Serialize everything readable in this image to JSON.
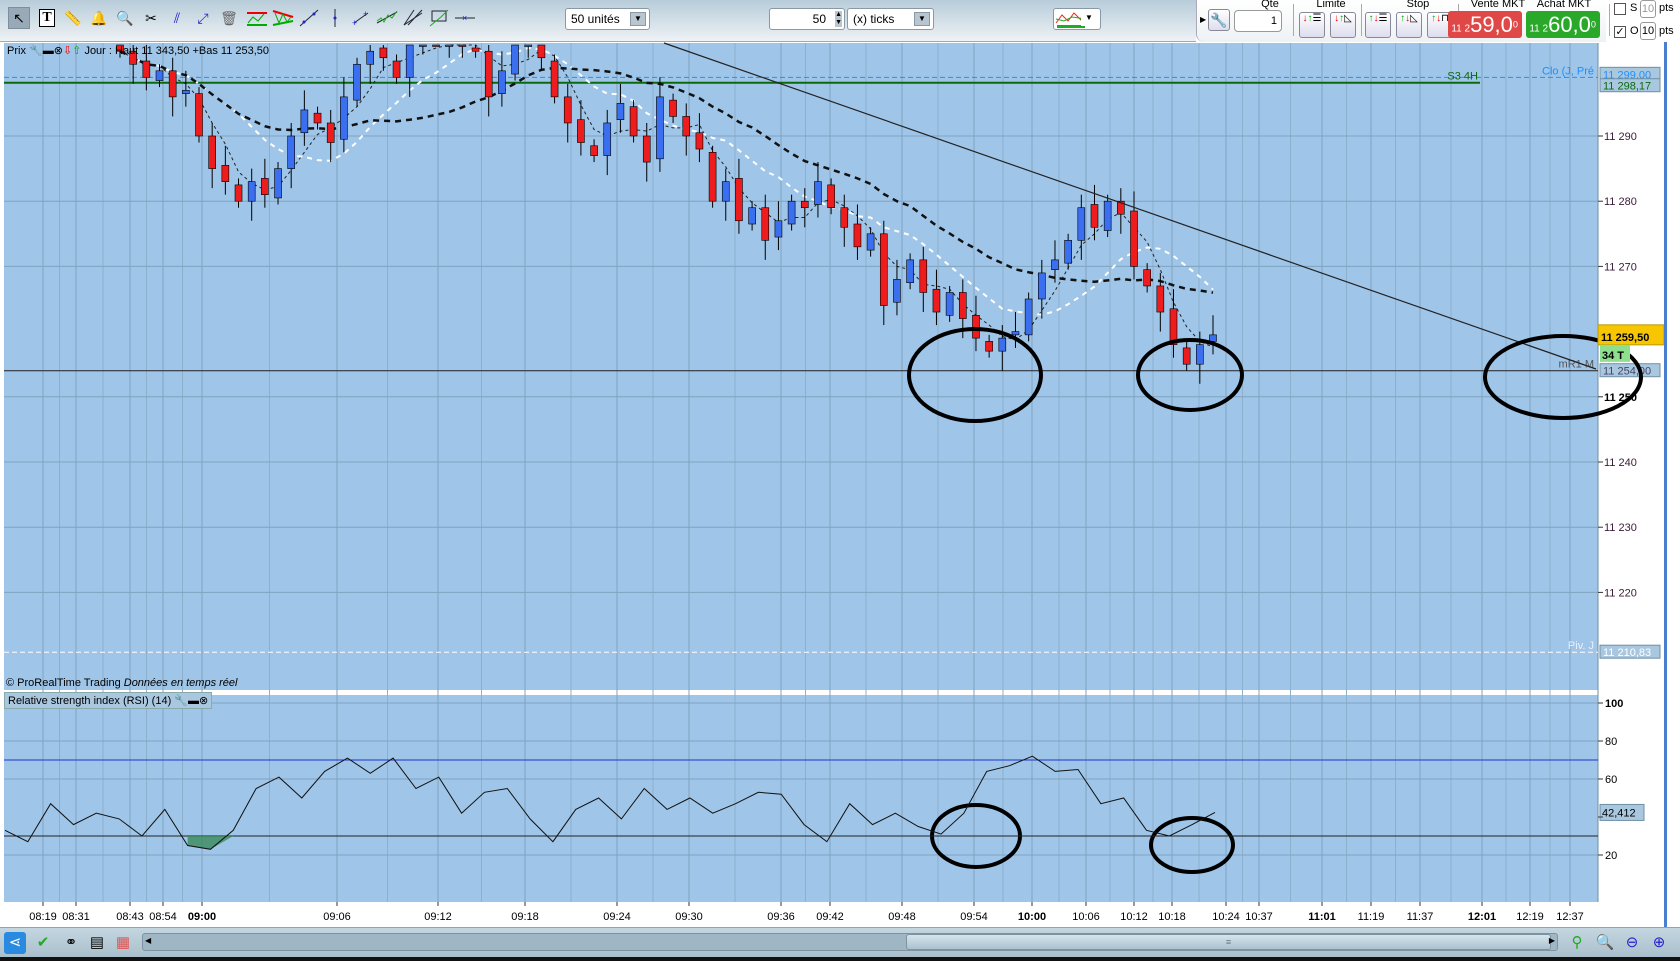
{
  "toolbar": {
    "tools": [
      "pointer-icon",
      "text-icon",
      "ruler-icon",
      "alarm-bell-icon",
      "zoom-icon",
      "tools-icon",
      "parallel-line-icon",
      "segment-icon",
      "trash-icon",
      "channel-icon",
      "triangle-channel-icon",
      "trendline-icon",
      "vertical-line-icon",
      "ray-icon",
      "regression-icon",
      "fan-icon",
      "fibonacci-icon",
      "horizontal-line-icon"
    ],
    "units_select": "50 unités",
    "ticks_value": "50",
    "ticks_select": "(x) ticks"
  },
  "trade": {
    "qte_label": "Qte",
    "qte_value": "1",
    "limite_label": "Limite",
    "stop_label": "Stop",
    "sell_label": "Vente MKT",
    "sell_prefix": "11 2",
    "sell_price": "59,0",
    "sell_sup": "0",
    "buy_label": "Achat MKT",
    "buy_prefix": "11 2",
    "buy_price": "60,0",
    "buy_sup": "0",
    "s_label": "S",
    "s_checked": false,
    "s_pts": "10",
    "o_label": "O",
    "o_checked": true,
    "o_pts": "10",
    "pts_label": "pts",
    "colors": {
      "sell": "#e03030",
      "buy": "#22a022"
    }
  },
  "price_panel": {
    "legend_title": "Prix",
    "legend_info": "Jour : Haut 11 343,50 +Bas 11 253,50",
    "copyright": "© ProRealTime Trading",
    "realtime": "Données en temps réel",
    "y_ticks": [
      "11 290",
      "11 280",
      "11 270",
      "11 250",
      "11 240",
      "11 230",
      "11 220"
    ],
    "y_tick_values": [
      11290,
      11280,
      11270,
      11250,
      11240,
      11230,
      11220
    ],
    "last_price": "11 259,50",
    "countdown": "34 T",
    "levels": [
      {
        "name": "Clo (J, Pré",
        "value": 11299.0,
        "label": "11 299,00",
        "color": "#1e90ff",
        "style": "dashed"
      },
      {
        "name": "S3 4H",
        "value": 11298.17,
        "label": "11 298,17",
        "color": "#0a6a0a",
        "style": "solid"
      },
      {
        "name": "mR1 M",
        "value": 11254.0,
        "label": "11 254,00",
        "color": "#222222",
        "style": "solid"
      },
      {
        "name": "Piv. J",
        "value": 11210.83,
        "label": "11 210,83",
        "color": "#ffffff",
        "style": "dashed"
      }
    ],
    "colors": {
      "background": "#9fc5e8",
      "up": "#3a6ff0",
      "down": "#ee1c1c"
    }
  },
  "chart_data": {
    "type": "candlestick",
    "closes": [
      11303,
      11301,
      11299,
      11300,
      11296,
      11297,
      11290,
      11285,
      11283,
      11280,
      11283,
      11281,
      11285,
      11290,
      11294,
      11292,
      11289,
      11296,
      11301,
      11303,
      11302,
      11299,
      11304,
      11306,
      11305,
      11306,
      11304,
      11303,
      11296,
      11300,
      11305,
      11306,
      11302,
      11296,
      11292,
      11289,
      11287,
      11292,
      11295,
      11290,
      11286,
      11296,
      11293,
      11290,
      11288,
      11280,
      11283,
      11277,
      11279,
      11274,
      11277,
      11280,
      11279,
      11283,
      11279,
      11276,
      11273,
      11275,
      11264,
      11268,
      11271,
      11266,
      11263,
      11266,
      11262,
      11259,
      11257,
      11259,
      11260,
      11265,
      11269,
      11271,
      11274,
      11279,
      11276,
      11280,
      11278,
      11270,
      11267,
      11263,
      11258,
      11255,
      11258,
      11259.5
    ],
    "x_ticks": [
      "08:19",
      "08:31",
      "08:43",
      "08:54",
      "09:00",
      "09:06",
      "09:12",
      "09:18",
      "09:24",
      "09:30",
      "09:36",
      "09:42",
      "09:48",
      "09:54",
      "10:00",
      "10:06",
      "10:12",
      "10:18",
      "10:24",
      "10:37",
      "11:01",
      "11:19",
      "11:37",
      "12:01",
      "12:19",
      "12:37"
    ],
    "x_ticks_bold": [
      "09:00",
      "10:00",
      "11:01",
      "12:01"
    ]
  },
  "rsi_panel": {
    "legend": "Relative strength index (RSI) (14)",
    "y_ticks": [
      "100",
      "80",
      "60",
      "20"
    ],
    "y_tick_values": [
      100,
      80,
      60,
      20
    ],
    "last_value": "42,412",
    "upper_level": 70,
    "lower_level": 30,
    "values": [
      33,
      27,
      47,
      36,
      42,
      39,
      30,
      44,
      25,
      23,
      33,
      55,
      61,
      50,
      64,
      71,
      63,
      71,
      55,
      61,
      42,
      53,
      55,
      39,
      27,
      44,
      50,
      39,
      55,
      44,
      50,
      42,
      47,
      53,
      52,
      36,
      27,
      47,
      36,
      42,
      35,
      31,
      42,
      64,
      67,
      72,
      64,
      65,
      47,
      50,
      33,
      30,
      36,
      42.4
    ]
  },
  "bottombar": {
    "left_icons": [
      "share-icon",
      "validate-icon",
      "link-icon",
      "list-icon",
      "order-book-icon"
    ],
    "right_icons": [
      "autoscale-icon",
      "zoom-fit-icon",
      "zoom-out-icon",
      "zoom-in-icon"
    ]
  }
}
